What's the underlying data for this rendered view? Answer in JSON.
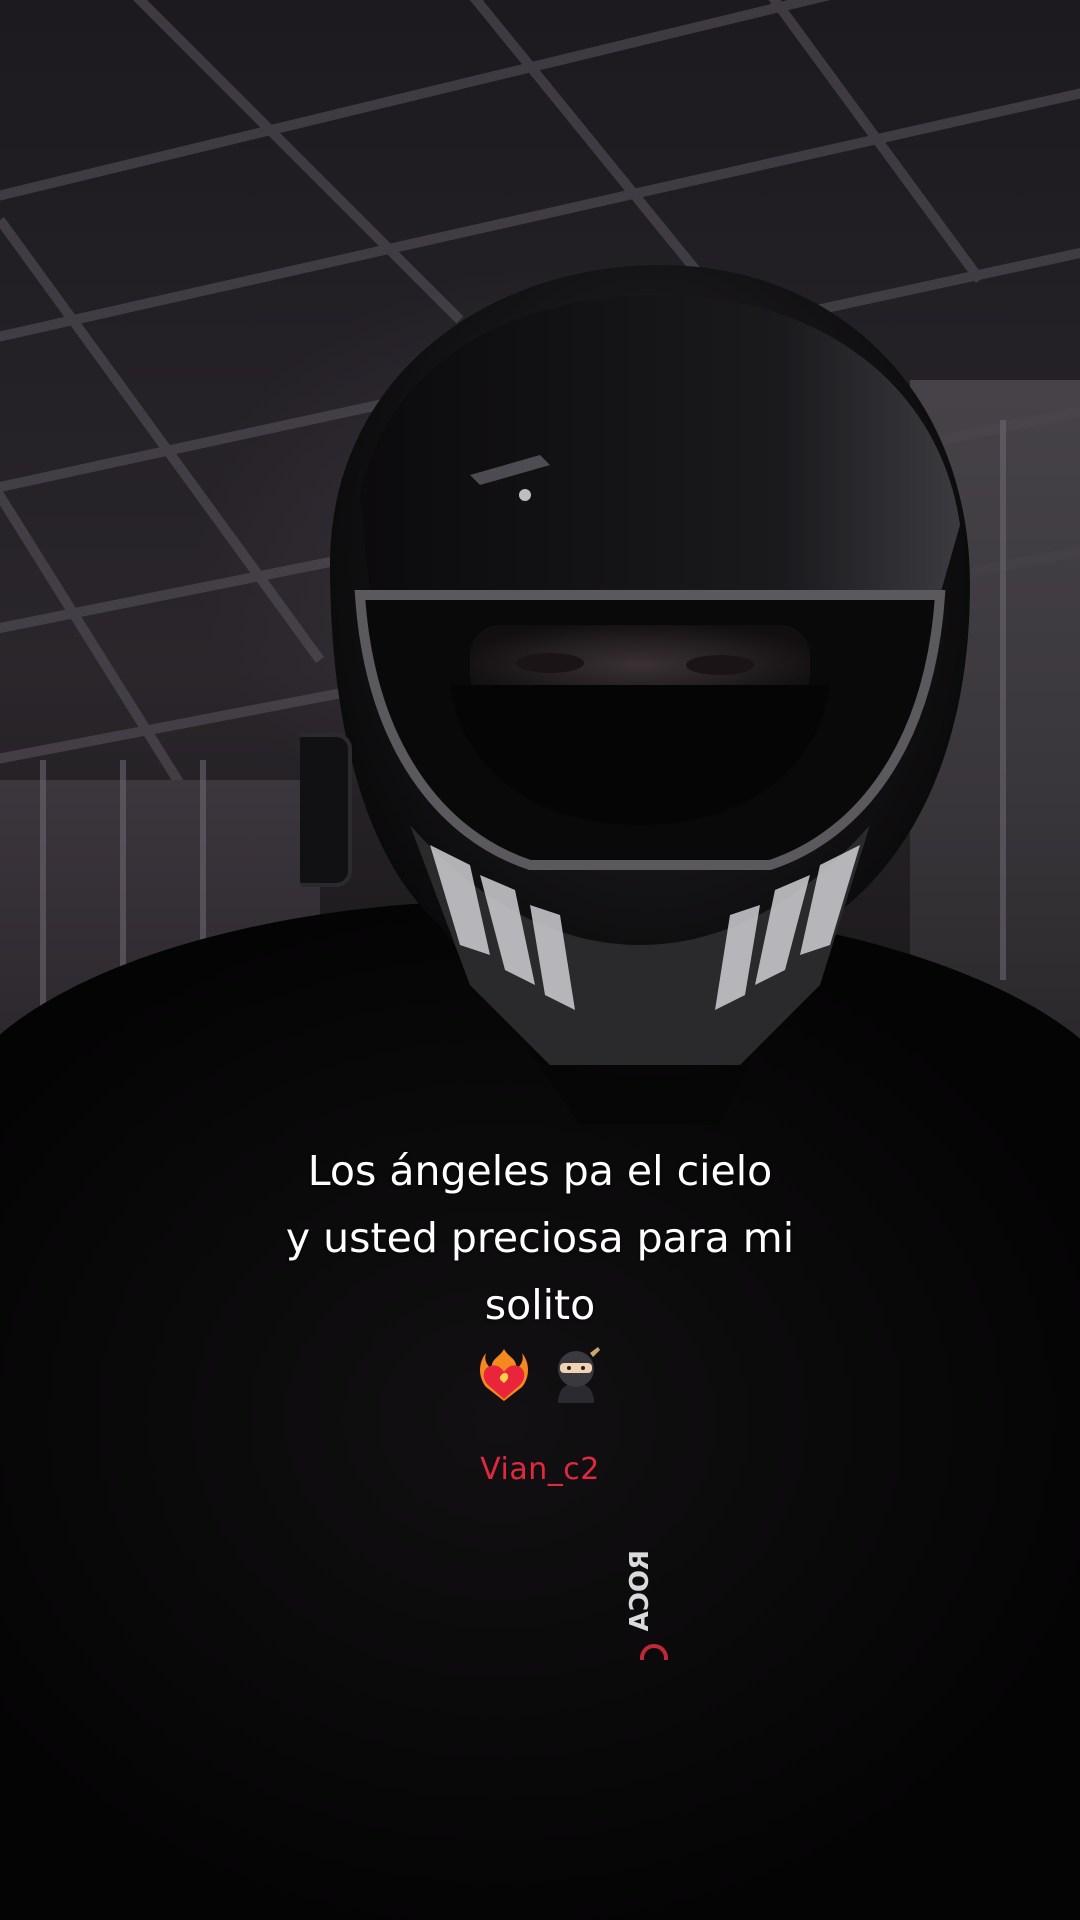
{
  "caption": {
    "line1": "Los ángeles pa el cielo",
    "line2": "y usted preciosa para mi",
    "line3": "solito",
    "emojis": [
      "heart-on-fire-icon",
      "ninja-icon"
    ]
  },
  "username": "Vian_c2",
  "colors": {
    "username": "#e0283e",
    "caption": "#ffffff"
  }
}
